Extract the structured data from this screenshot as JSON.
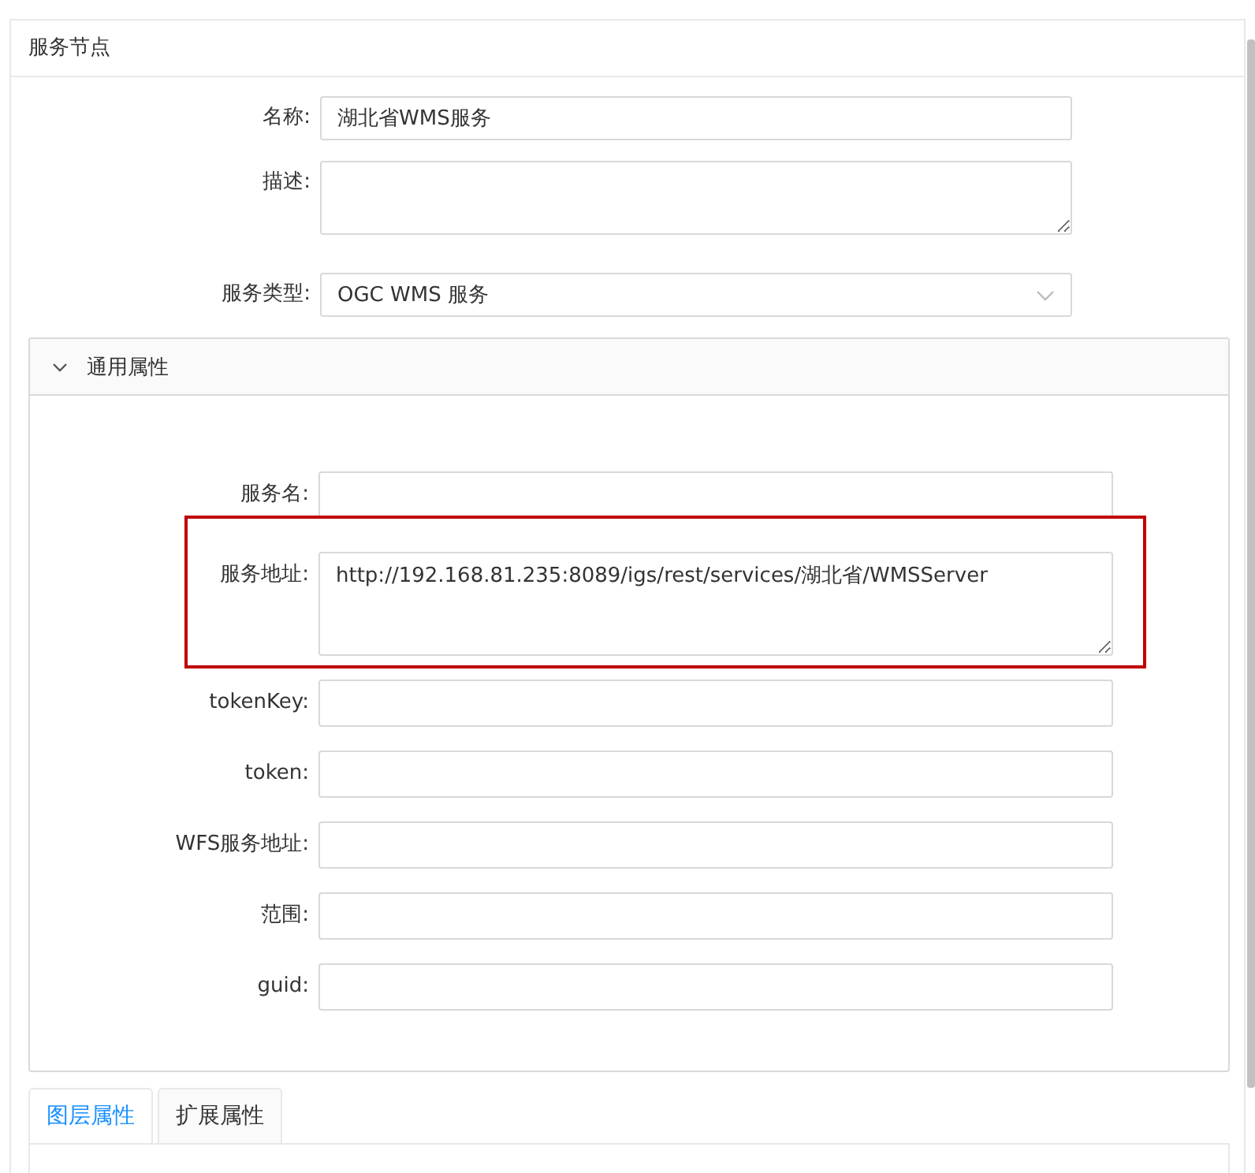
{
  "card": {
    "title": "服务节点"
  },
  "form": [
    {
      "kind": "input",
      "label": "名称:",
      "value": "湖北省WMS服务"
    },
    {
      "kind": "textarea",
      "label": "描述:"
    },
    {
      "kind": "select",
      "label": "服务类型:",
      "value": "OGC WMS 服务"
    }
  ],
  "panel": {
    "title": "通用属性",
    "expanded": true,
    "fields": [
      {
        "kind": "input",
        "label": "服务名:",
        "highlighted": false
      },
      {
        "kind": "textarea",
        "label": "服务地址:",
        "value": "http://192.168.81.235:8089/igs/rest/services/湖北省/WMSServer",
        "highlighted": true
      },
      {
        "kind": "input",
        "label": "tokenKey:",
        "highlighted": false
      },
      {
        "kind": "input",
        "label": "token:",
        "highlighted": false
      },
      {
        "kind": "input",
        "label": "WFS服务地址:",
        "highlighted": false
      },
      {
        "kind": "input",
        "label": "范围:",
        "highlighted": false
      },
      {
        "kind": "input",
        "label": "guid:",
        "highlighted": false
      }
    ]
  },
  "tabs": [
    {
      "label": "图层属性",
      "selected": true
    },
    {
      "label": "扩展属性",
      "selected": false
    }
  ]
}
